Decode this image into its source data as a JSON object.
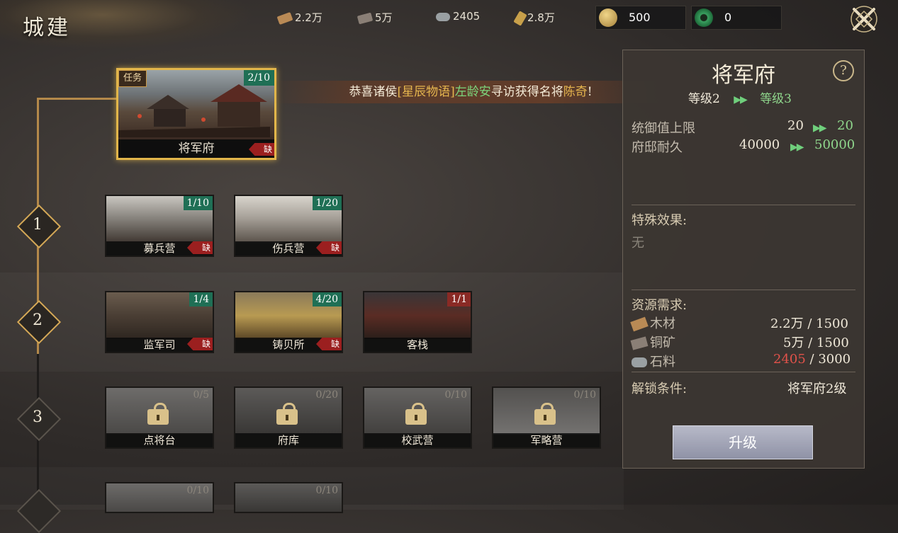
{
  "header": {
    "title": "城建"
  },
  "resources": [
    {
      "icon": "wood-icon",
      "value": "2.2万",
      "color": "#b98a55"
    },
    {
      "icon": "copper-icon",
      "value": "5万",
      "color": "#8a7f76"
    },
    {
      "icon": "stone-icon",
      "value": "2405",
      "color": "#9aa0a3"
    },
    {
      "icon": "grain-icon",
      "value": "2.8万",
      "color": "#c8a04a"
    }
  ],
  "currency": [
    {
      "icon": "gold-coin-icon",
      "value": "500",
      "color": "#d4b25a"
    },
    {
      "icon": "jade-icon",
      "value": "0",
      "color": "#3a9a5a"
    }
  ],
  "notice": {
    "prefix": "恭喜诸侯",
    "player": "[星辰物语]",
    "name": "左龄安",
    "middle": "寻访获得名将",
    "general": "陈奇",
    "suffix": "!"
  },
  "main_building": {
    "task_tag": "任务",
    "level": "2/10",
    "name": "将军府",
    "lack": "缺"
  },
  "tiers": [
    {
      "num": "1",
      "buildings": [
        {
          "name": "募兵营",
          "level": "1/10",
          "lack": "缺"
        },
        {
          "name": "伤兵营",
          "level": "1/20",
          "lack": "缺"
        }
      ]
    },
    {
      "num": "2",
      "buildings": [
        {
          "name": "监军司",
          "level": "1/4",
          "lack": "缺"
        },
        {
          "name": "铸贝所",
          "level": "4/20",
          "lack": "缺"
        },
        {
          "name": "客栈",
          "level": "1/1"
        }
      ]
    },
    {
      "num": "3",
      "buildings": [
        {
          "name": "点将台",
          "level": "0/5"
        },
        {
          "name": "府库",
          "level": "0/20"
        },
        {
          "name": "校武营",
          "level": "0/10"
        },
        {
          "name": "军略营",
          "level": "0/10"
        }
      ]
    },
    {
      "buildings": [
        {
          "level": "0/10"
        },
        {
          "level": "0/10"
        }
      ]
    }
  ],
  "panel": {
    "title": "将军府",
    "help": "?",
    "level_from": "等级2",
    "level_to": "等级3",
    "stats": [
      {
        "label": "统御值上限",
        "from": "20",
        "to": "20"
      },
      {
        "label": "府邸耐久",
        "from": "40000",
        "to": "50000"
      }
    ],
    "special_label": "特殊效果:",
    "special_value": "无",
    "req_label": "资源需求:",
    "requirements": [
      {
        "label": "木材",
        "have": "2.2万",
        "need": "1500",
        "enough": true
      },
      {
        "label": "铜矿",
        "have": "5万",
        "need": "1500",
        "enough": true
      },
      {
        "label": "石料",
        "have": "2405",
        "need": "3000",
        "enough": false
      }
    ],
    "unlock_label": "解锁条件:",
    "unlock_value": "将军府2级",
    "upgrade_button": "升级"
  }
}
